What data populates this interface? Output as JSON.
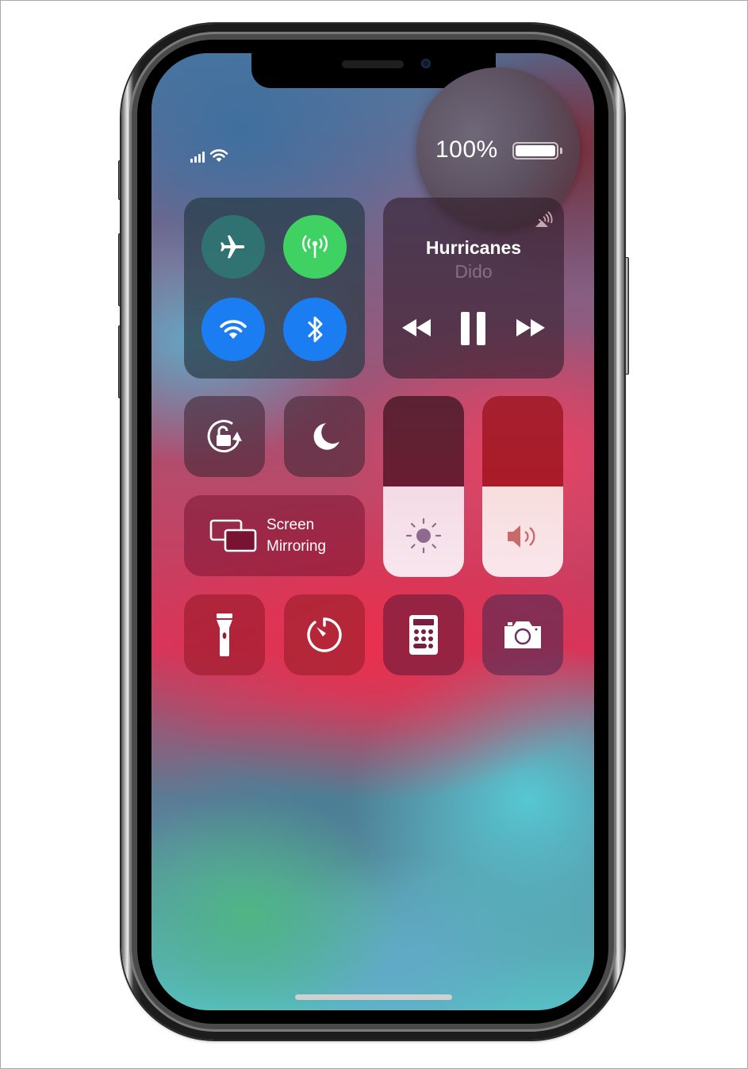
{
  "status_bar": {
    "signal_bars": 4,
    "wifi_icon": "wifi-icon",
    "battery_percent_label": "100%",
    "battery_level": 1.0
  },
  "connectivity": {
    "airplane_mode": {
      "icon": "airplane-icon",
      "on": false,
      "color": "#2e7f7a"
    },
    "cellular_data": {
      "icon": "antenna-icon",
      "on": true,
      "color": "#3fd262"
    },
    "wifi": {
      "icon": "wifi-icon",
      "on": true,
      "color": "#1a7df2"
    },
    "bluetooth": {
      "icon": "bluetooth-icon",
      "on": true,
      "color": "#1a7df2"
    }
  },
  "now_playing": {
    "title": "Hurricanes",
    "artist": "Dido",
    "airplay_icon": "airplay-audio-icon",
    "controls": [
      "rewind-icon",
      "pause-icon",
      "fast-forward-icon"
    ]
  },
  "toggles": {
    "orientation_lock": {
      "icon": "orientation-lock-icon"
    },
    "do_not_disturb": {
      "icon": "moon-icon"
    }
  },
  "screen_mirroring": {
    "label_line1": "Screen",
    "label_line2": "Mirroring",
    "icon": "screen-mirroring-icon"
  },
  "sliders": {
    "brightness": {
      "icon": "sun-icon",
      "level": 0.5
    },
    "volume": {
      "icon": "speaker-icon",
      "level": 0.5
    }
  },
  "shortcuts": [
    {
      "name": "flashlight",
      "icon": "flashlight-icon"
    },
    {
      "name": "timer",
      "icon": "timer-icon"
    },
    {
      "name": "calculator",
      "icon": "calculator-icon"
    },
    {
      "name": "camera",
      "icon": "camera-icon"
    }
  ]
}
